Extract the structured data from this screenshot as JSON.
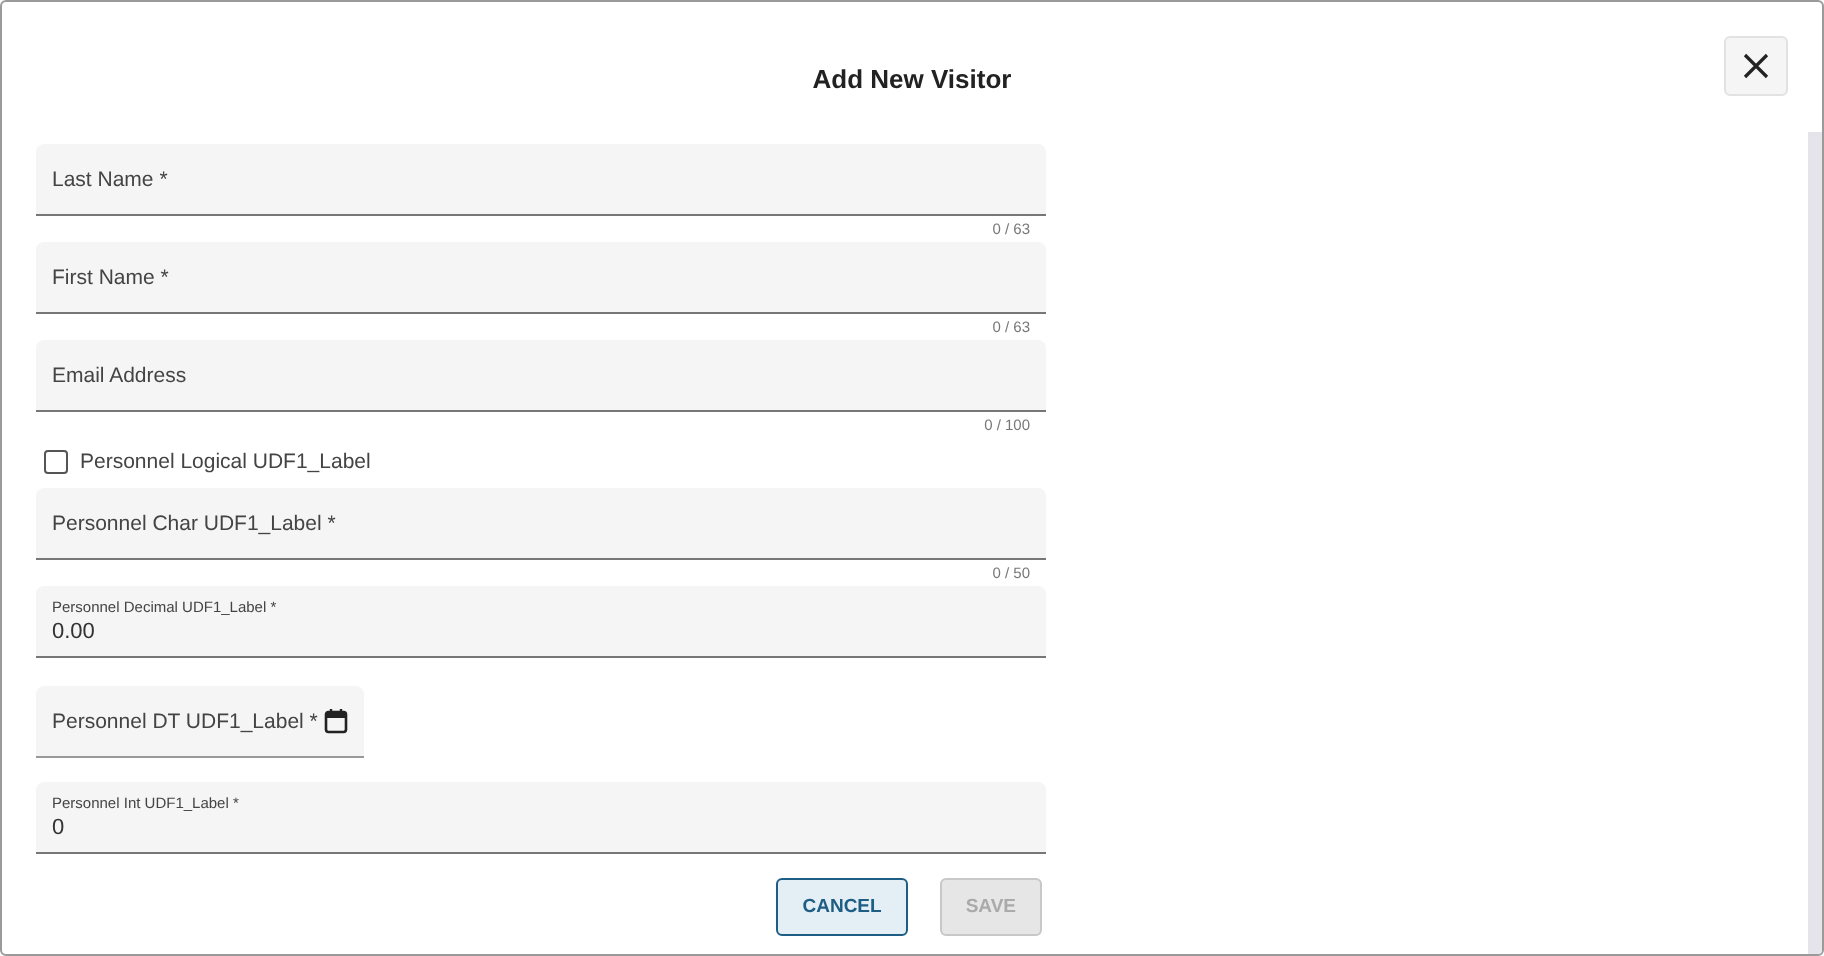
{
  "dialog": {
    "title": "Add New Visitor"
  },
  "fields": [
    {
      "kind": "text",
      "label": "Last Name *",
      "counter": "0 / 63"
    },
    {
      "kind": "text",
      "label": "First Name *",
      "counter": "0 / 63"
    },
    {
      "kind": "text",
      "label": "Email Address",
      "counter": "0 / 100"
    },
    {
      "kind": "checkbox",
      "label": "Personnel Logical UDF1_Label",
      "checked": false
    },
    {
      "kind": "text",
      "label": "Personnel Char UDF1_Label *",
      "counter": "0 / 50"
    },
    {
      "kind": "filled",
      "label": "Personnel Decimal UDF1_Label *",
      "value": "0.00"
    },
    {
      "kind": "date",
      "label": "Personnel DT UDF1_Label *"
    },
    {
      "kind": "filled",
      "label": "Personnel Int UDF1_Label *",
      "value": "0"
    }
  ],
  "buttons": [
    {
      "label": "CANCEL",
      "kind": "outlined",
      "disabled": false
    },
    {
      "label": "SAVE",
      "kind": "filled",
      "disabled": true
    }
  ]
}
